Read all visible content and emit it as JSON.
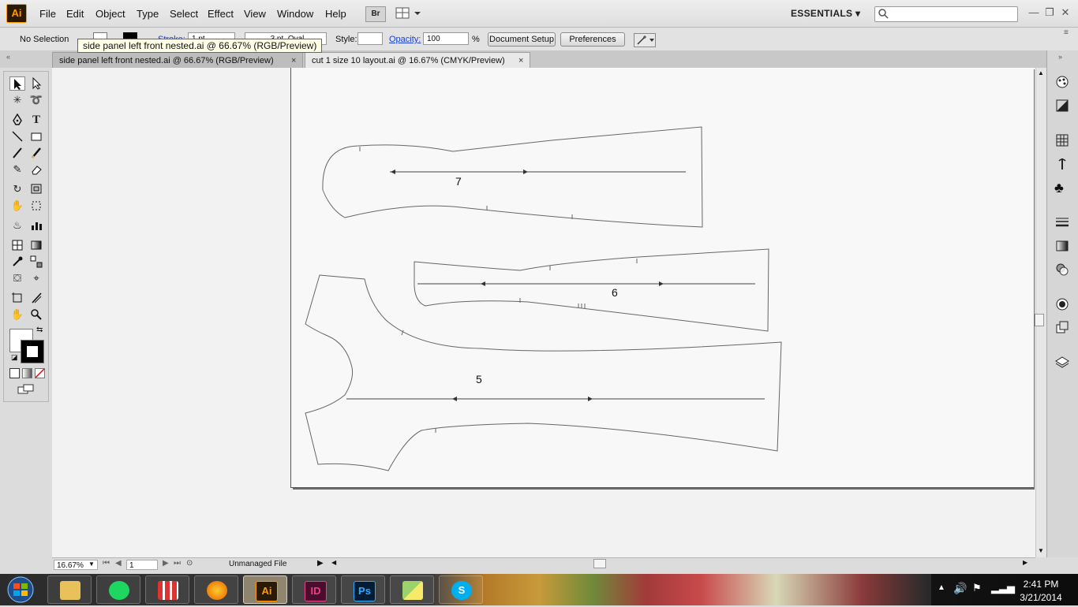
{
  "app": {
    "logo_text": "Ai"
  },
  "menu": [
    "File",
    "Edit",
    "Object",
    "Type",
    "Select",
    "Effect",
    "View",
    "Window",
    "Help"
  ],
  "bridge_label": "Br",
  "workspace": "ESSENTIALS",
  "control_bar": {
    "selection": "No Selection",
    "stroke_label": "Stroke:",
    "stroke_weight": "1 pt",
    "brush": "3 pt. Oval",
    "style_label": "Style:",
    "opacity_label": "Opacity:",
    "opacity_value": "100",
    "opacity_unit": "%",
    "document_setup": "Document Setup",
    "preferences": "Preferences"
  },
  "tooltip": "side panel left front nested.ai @ 66.67% (RGB/Preview)",
  "tabs": [
    {
      "label": "side panel left front nested.ai @ 66.67% (RGB/Preview)",
      "close": "×",
      "active": false
    },
    {
      "label": "cut 1 size 10 layout.ai @ 16.67% (CMYK/Preview)",
      "close": "×",
      "active": true
    }
  ],
  "pieces": [
    {
      "number": "7"
    },
    {
      "number": "6"
    },
    {
      "number": "5"
    }
  ],
  "status_bar": {
    "zoom": "16.67%",
    "artboard": "1",
    "file_status": "Unmanaged File"
  },
  "taskbar": {
    "apps": [
      {
        "name": "file-explorer",
        "label": ""
      },
      {
        "name": "spotify",
        "label": ""
      },
      {
        "name": "app-grid",
        "label": ""
      },
      {
        "name": "firefox",
        "label": ""
      },
      {
        "name": "illustrator",
        "label": "Ai"
      },
      {
        "name": "indesign",
        "label": "ID"
      },
      {
        "name": "photoshop",
        "label": "Ps"
      },
      {
        "name": "sticky-notes",
        "label": ""
      },
      {
        "name": "skype",
        "label": ""
      }
    ],
    "time": "2:41 PM",
    "date": "3/21/2014"
  },
  "colors": {
    "illustrator_orange": "#ff9a00",
    "indesign_pink": "#e8408a",
    "photoshop_blue": "#31a8ff",
    "skype_blue": "#00aff0",
    "spotify_green": "#1ed760"
  }
}
